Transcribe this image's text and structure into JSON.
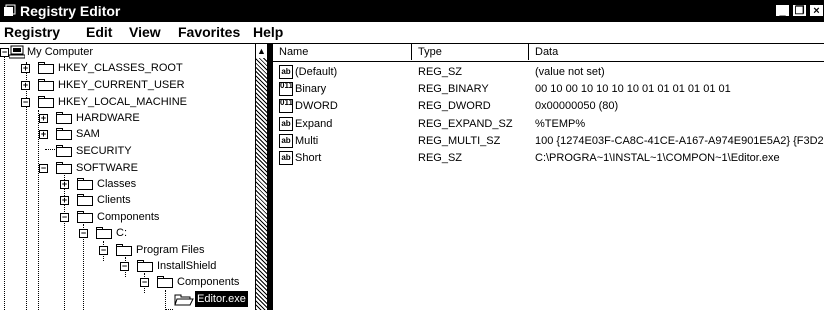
{
  "window": {
    "title": "Registry Editor",
    "icon": "regedit-icon",
    "controls": {
      "minimize": "_",
      "maximize": "❐",
      "close": "×"
    }
  },
  "menu": [
    "Registry",
    "Edit",
    "View",
    "Favorites",
    "Help"
  ],
  "tree": {
    "root": "My Computer",
    "hkcr": "HKEY_CLASSES_ROOT",
    "hkcu": "HKEY_CURRENT_USER",
    "hklm": "HKEY_LOCAL_MACHINE",
    "hardware": "HARDWARE",
    "sam": "SAM",
    "security": "SECURITY",
    "software": "SOFTWARE",
    "classes": "Classes",
    "clients": "Clients",
    "components": "Components",
    "c": "C:",
    "program_files": "Program Files",
    "installshield": "InstallShield",
    "components2": "Components",
    "editor": "Editor.exe",
    "expanded_glyph": "−",
    "collapsed_glyph": "+"
  },
  "list": {
    "columns": [
      "Name",
      "Type",
      "Data"
    ],
    "rows": [
      {
        "icon": "string-value-icon",
        "glyph": "ab",
        "name": "(Default)",
        "type": "REG_SZ",
        "data": "(value not set)"
      },
      {
        "icon": "binary-value-icon",
        "glyph": "011",
        "name": "Binary",
        "type": "REG_BINARY",
        "data": "00 10 00 10 10 10 10 01 01 01 01 01 01"
      },
      {
        "icon": "dword-value-icon",
        "glyph": "011",
        "name": "DWORD",
        "type": "REG_DWORD",
        "data": "0x00000050 (80)"
      },
      {
        "icon": "string-value-icon",
        "glyph": "ab",
        "name": "Expand",
        "type": "REG_EXPAND_SZ",
        "data": "%TEMP%"
      },
      {
        "icon": "string-value-icon",
        "glyph": "ab",
        "name": "Multi",
        "type": "REG_MULTI_SZ",
        "data": "100 {1274E03F-CA8C-41CE-A167-A974E901E5A2} {F3D2"
      },
      {
        "icon": "string-value-icon",
        "glyph": "ab",
        "name": "Short",
        "type": "REG_SZ",
        "data": "C:\\PROGRA~1\\INSTAL~1\\COMPON~1\\Editor.exe"
      }
    ]
  }
}
